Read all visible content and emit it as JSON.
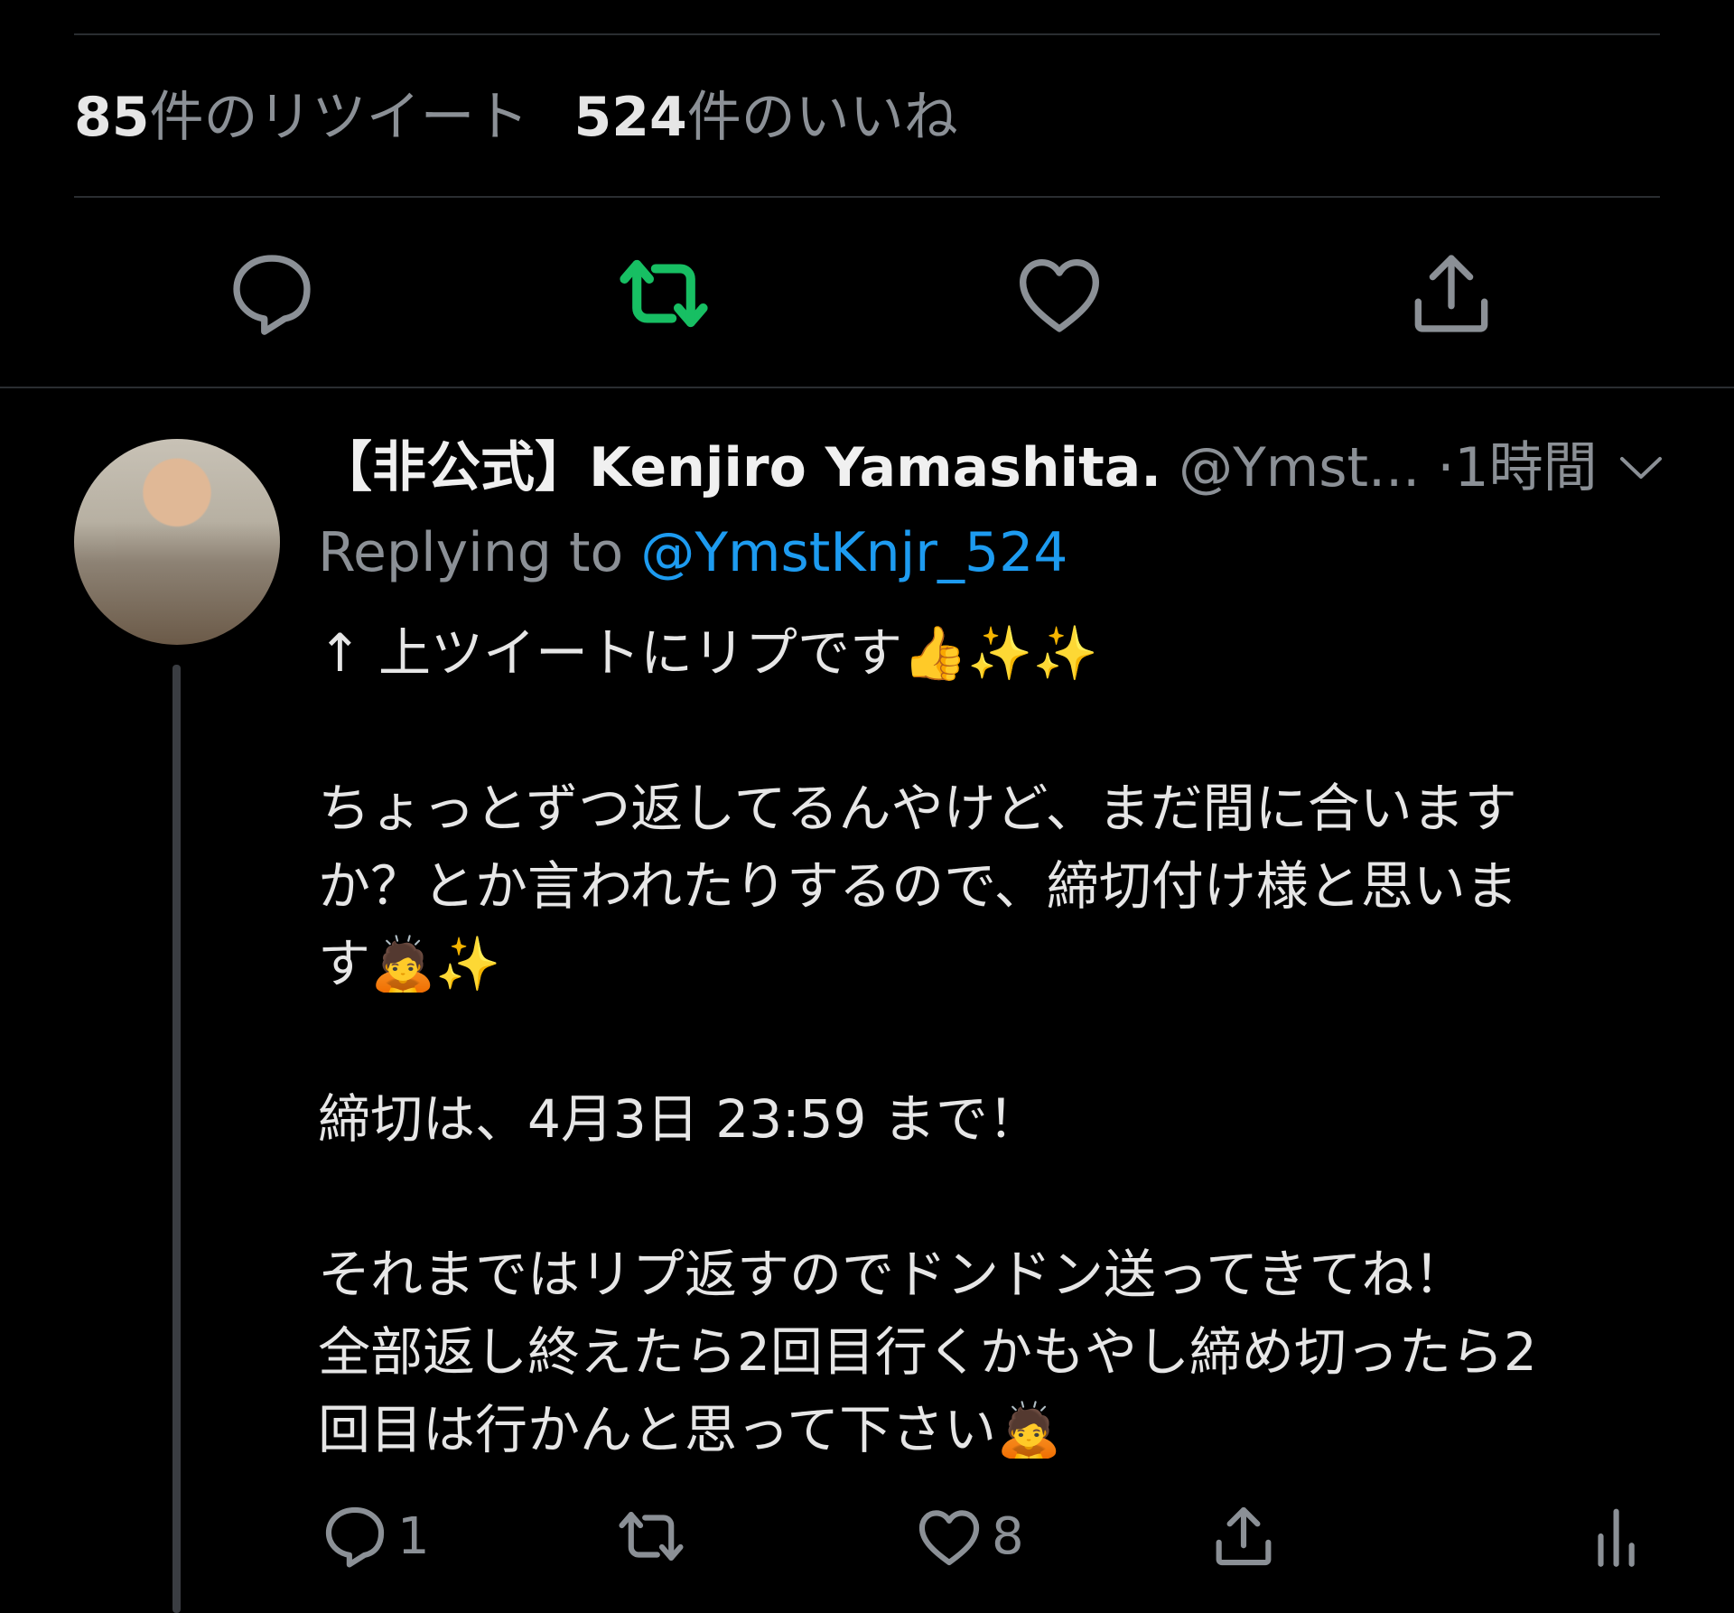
{
  "stats": {
    "retweets_count": "85",
    "retweets_label": "件のリツイート",
    "likes_count": "524",
    "likes_label": "件のいいね"
  },
  "actions": {
    "reply_icon": "reply-icon",
    "retweet_icon": "retweet-icon",
    "like_icon": "heart-icon",
    "share_icon": "share-icon",
    "retweet_color": "#17bf63",
    "icon_color": "#8b9096"
  },
  "reply_tweet": {
    "display_name": "【非公式】Kenjiro Yamashita.",
    "handle": "@Ymst...",
    "separator": "·",
    "time": "1時間",
    "replying_prefix": "Replying to",
    "replying_to": "@YmstKnjr_524",
    "lines": [
      "↑ 上ツイートにリプです👍✨✨",
      "",
      "ちょっとずつ返してるんやけど、まだ間に合います",
      "か？とか言われたりするので、締切付け様と思いま",
      "す🙇✨",
      "",
      "締切は、4月3日 23:59 まで！",
      "",
      "それまではリプ返すのでドンドン送ってきてね！",
      "全部返し終えたら2回目行くかもやし締め切ったら2",
      "回目は行かんと思って下さい🙇"
    ],
    "reply_count": "1",
    "retweet_count": "",
    "like_count": "8",
    "accent_color": "#1d9bf0"
  }
}
